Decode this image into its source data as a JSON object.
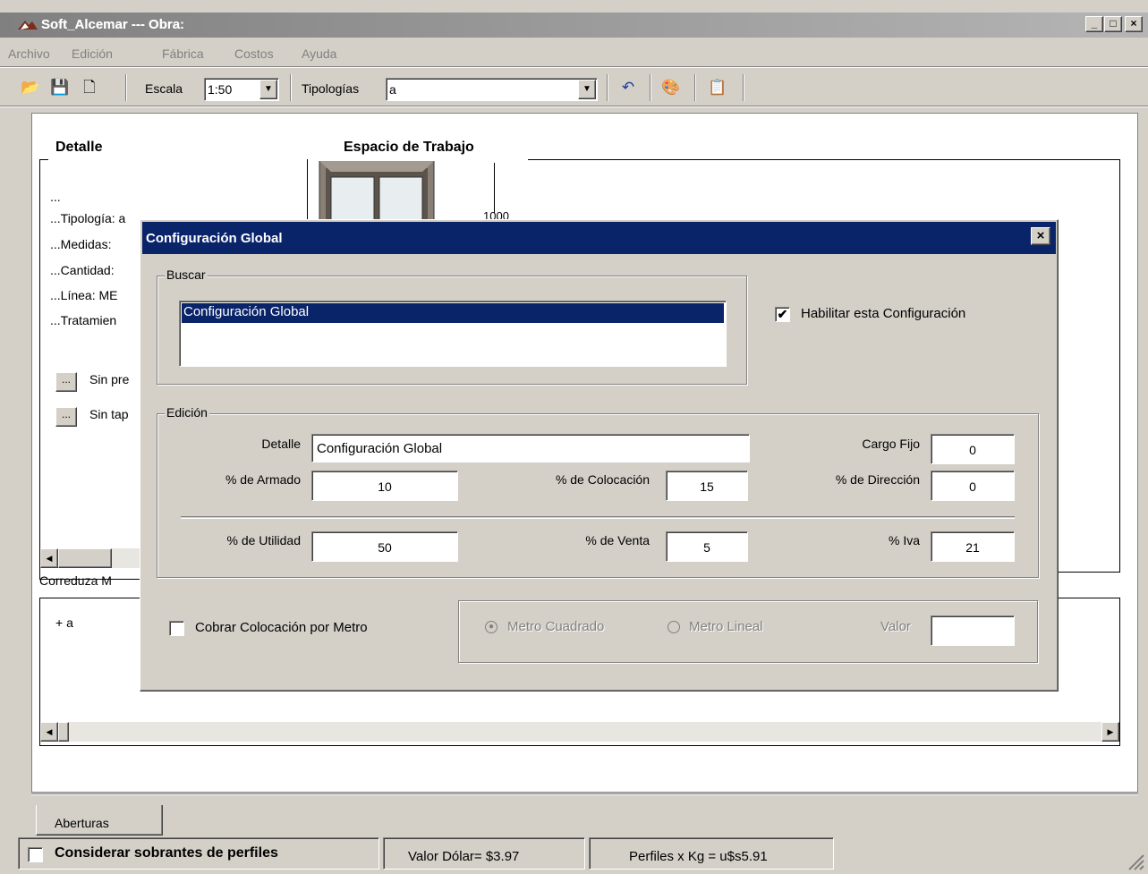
{
  "window": {
    "title": "Soft_Alcemar --- Obra:",
    "min": "_",
    "max": "□",
    "close": "×"
  },
  "menu": [
    {
      "label": "Archivo"
    },
    {
      "label": "Edición"
    },
    {
      "label": "Fábrica"
    },
    {
      "label": "Costos"
    },
    {
      "label": "Ayuda"
    }
  ],
  "toolbar": {
    "escala_label": "Escala",
    "escala_value": "1:50",
    "tipologias_label": "Tipologías",
    "tipologias_value": "a",
    "icons": {
      "open": "📂",
      "save": "💾",
      "new": "🗋",
      "undo": "↶",
      "paint": "🎨",
      "copy": "📋"
    }
  },
  "workspace": {
    "detalle_title": "Detalle",
    "espacio_title": "Espacio de Trabajo",
    "dim_label": "1000",
    "lines": [
      "...",
      "...Tipología: a",
      "...Medidas:",
      "...Cantidad:",
      "...Línea: ME",
      "...Tratamien"
    ],
    "btn1_label": "...",
    "btn1_text": "Sin pre",
    "btn2_label": "...",
    "btn2_text": "Sin tap",
    "lower_label": "Correduza M",
    "list_item": "+ a"
  },
  "dialog": {
    "title": "Configuración Global",
    "buscar_label": "Buscar",
    "buscar_items": [
      "Configuración Global"
    ],
    "habilitar_label": "Habilitar esta Configuración",
    "habilitar_checked": "✔",
    "edicion_label": "Edición",
    "detalle_label": "Detalle",
    "detalle_value": "Configuración Global",
    "cargo_fijo_label": "Cargo Fijo",
    "cargo_fijo_value": "0",
    "armado_label": "% de Armado",
    "armado_value": "10",
    "colocacion_label": "% de Colocación",
    "colocacion_value": "15",
    "direccion_label": "% de Dirección",
    "direccion_value": "0",
    "utilidad_label": "% de Utilidad",
    "utilidad_value": "50",
    "venta_label": "% de Venta",
    "venta_value": "5",
    "iva_label": "% Iva",
    "iva_value": "21",
    "cobrar_label": "Cobrar Colocación por Metro",
    "metro_cuadrado_label": "Metro Cuadrado",
    "metro_lineal_label": "Metro Lineal",
    "valor_label": "Valor",
    "valor_value": ""
  },
  "tabs": [
    {
      "label": "Aberturas"
    }
  ],
  "status": {
    "considerar_label": "Considerar sobrantes de perfiles",
    "dolar": "Valor Dólar= $3.97",
    "perfiles": "Perfiles x Kg = u$s5.91"
  }
}
